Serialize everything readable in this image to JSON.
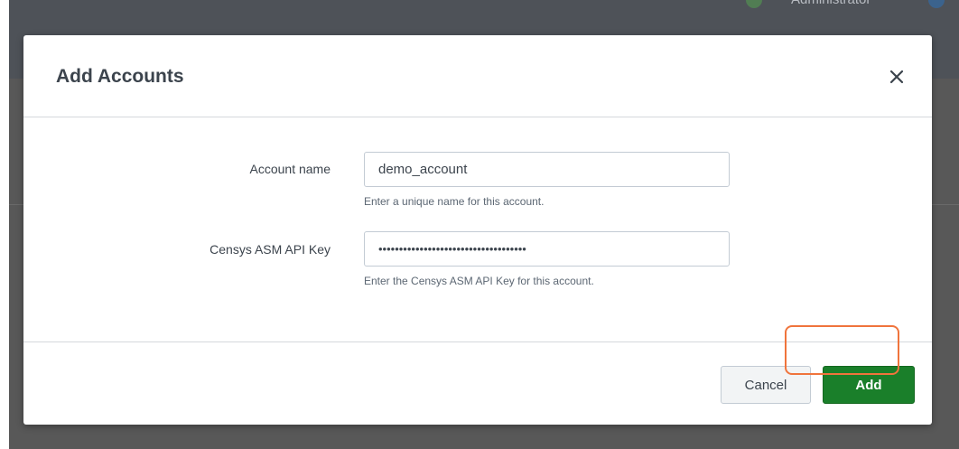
{
  "background": {
    "user_label": "Administrator"
  },
  "dialog": {
    "title": "Add Accounts",
    "close_glyph": "×"
  },
  "form": {
    "account_name": {
      "label": "Account name",
      "value": "demo_account",
      "help": "Enter a unique name for this account."
    },
    "api_key": {
      "label": "Censys ASM API Key",
      "value": "••••••••••••••••••••••••••••••••••••",
      "help": "Enter the Censys ASM API Key for this account."
    }
  },
  "footer": {
    "cancel_label": "Cancel",
    "add_label": "Add"
  },
  "colors": {
    "primary_green": "#1a7f2a",
    "highlight_orange": "#f0743c",
    "backdrop": "#585858"
  },
  "icons": {
    "close": "close-icon"
  }
}
